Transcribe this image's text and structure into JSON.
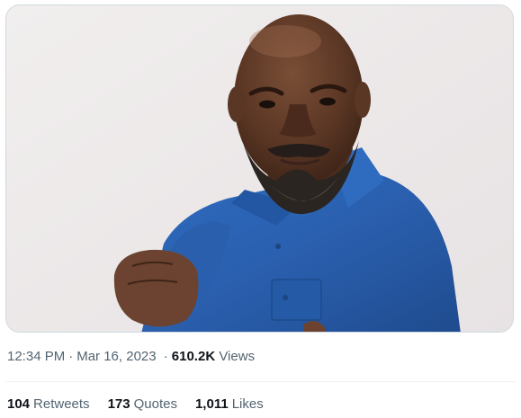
{
  "tweet": {
    "time": "12:34 PM",
    "date": "Mar 16, 2023",
    "separator": "·",
    "views_count": "610.2K",
    "views_label": "Views",
    "stats": {
      "retweets_count": "104",
      "retweets_label": "Retweets",
      "quotes_count": "173",
      "quotes_label": "Quotes",
      "likes_count": "1,011",
      "likes_label": "Likes"
    }
  },
  "colors": {
    "muted_text": "#536471",
    "primary_text": "#0f1419",
    "border": "#cfd9de",
    "photo_background": "#efeae9",
    "shirt_blue": "#2a5fae"
  }
}
